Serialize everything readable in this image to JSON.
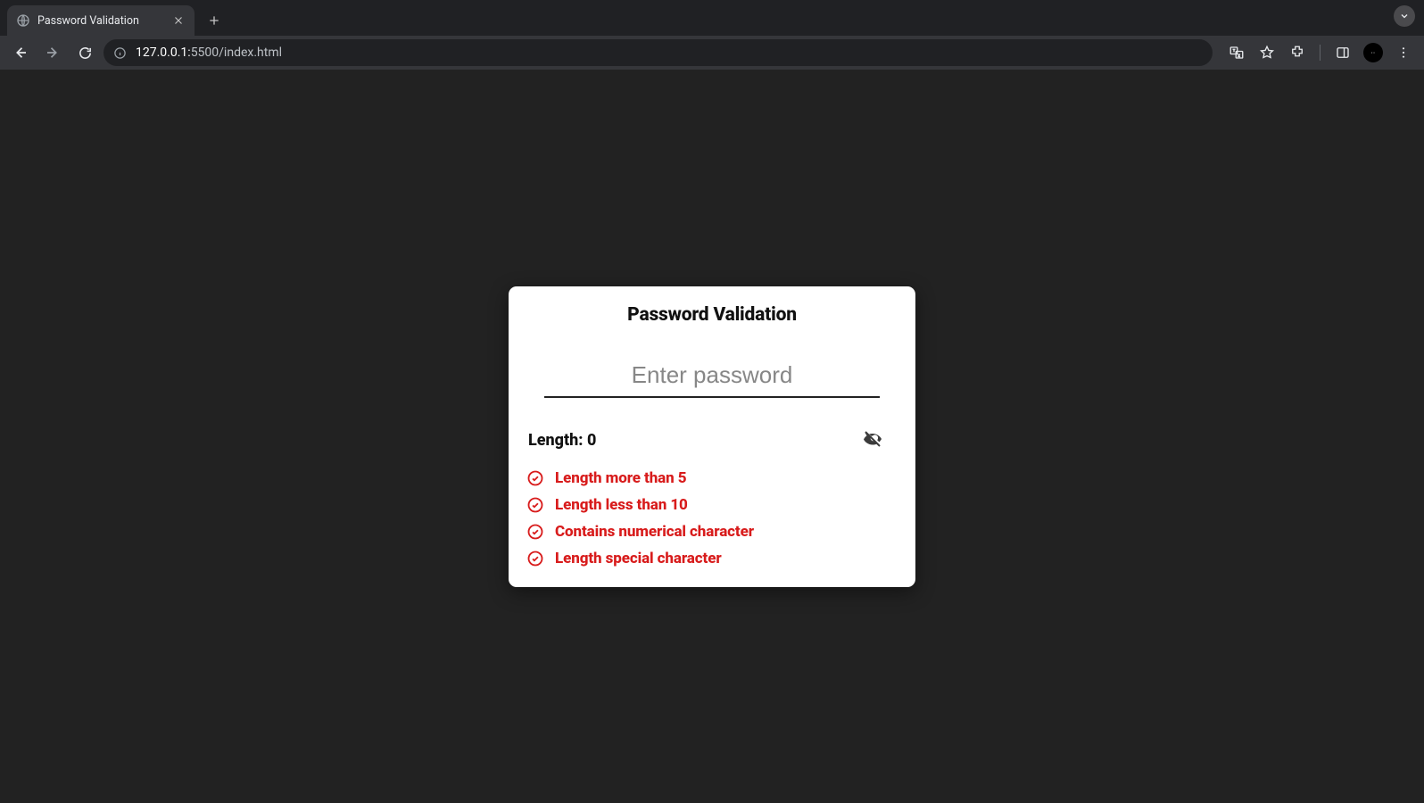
{
  "browser": {
    "tab_title": "Password Validation",
    "url_host": "127.0.0.1:",
    "url_rest": "5500/index.html"
  },
  "card": {
    "title": "Password Validation",
    "placeholder": "Enter password",
    "length_prefix": "Length: ",
    "length_value": "0",
    "rules": {
      "r1": "Length more than 5",
      "r2": "Length less than 10",
      "r3": "Contains numerical character",
      "r4": "Length special character"
    }
  }
}
